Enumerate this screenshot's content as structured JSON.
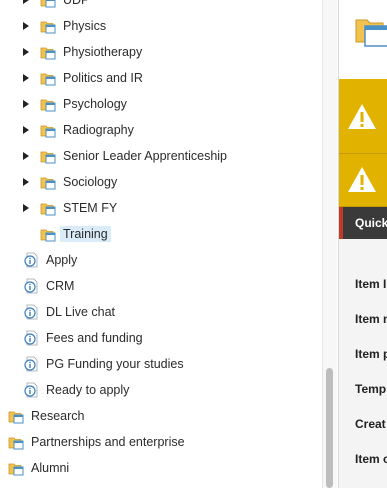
{
  "tree": {
    "items": [
      {
        "label": "UDP",
        "icon": "folder-page-icon",
        "arrow": true,
        "selected": false
      },
      {
        "label": "Physics",
        "icon": "folder-page-icon",
        "arrow": true,
        "selected": false
      },
      {
        "label": "Physiotherapy",
        "icon": "folder-page-icon",
        "arrow": true,
        "selected": false
      },
      {
        "label": "Politics and IR",
        "icon": "folder-page-icon",
        "arrow": true,
        "selected": false
      },
      {
        "label": "Psychology",
        "icon": "folder-page-icon",
        "arrow": true,
        "selected": false
      },
      {
        "label": "Radiography",
        "icon": "folder-page-icon",
        "arrow": true,
        "selected": false
      },
      {
        "label": "Senior Leader Apprenticeship",
        "icon": "folder-page-icon",
        "arrow": true,
        "selected": false
      },
      {
        "label": "Sociology",
        "icon": "folder-page-icon",
        "arrow": true,
        "selected": false
      },
      {
        "label": "STEM FY",
        "icon": "folder-page-icon",
        "arrow": true,
        "selected": false
      },
      {
        "label": "Training",
        "icon": "folder-page-icon",
        "arrow": false,
        "selected": true
      },
      {
        "label": "Apply",
        "icon": "info-page-icon",
        "arrow": false,
        "selected": false
      },
      {
        "label": "CRM",
        "icon": "info-page-icon",
        "arrow": false,
        "selected": false
      },
      {
        "label": "DL Live chat",
        "icon": "info-page-icon",
        "arrow": false,
        "selected": false
      },
      {
        "label": "Fees and funding",
        "icon": "info-page-icon",
        "arrow": false,
        "selected": false
      },
      {
        "label": "PG Funding your studies",
        "icon": "info-page-icon",
        "arrow": false,
        "selected": false
      },
      {
        "label": "Ready to apply",
        "icon": "info-page-icon",
        "arrow": false,
        "selected": false
      },
      {
        "label": "Research",
        "icon": "folder-page-icon",
        "arrow": false,
        "selected": false
      },
      {
        "label": "Partnerships and enterprise",
        "icon": "folder-page-icon",
        "arrow": false,
        "selected": false
      },
      {
        "label": "Alumni",
        "icon": "folder-page-icon",
        "arrow": false,
        "selected": false
      }
    ]
  },
  "right_panel": {
    "header_icon": "window-folder-icon",
    "warnings": [
      {
        "icon": "warning-icon"
      },
      {
        "icon": "warning-icon"
      }
    ],
    "quick_info_label": "Quick",
    "fields": [
      "Item I",
      "Item n",
      "Item p",
      "Temp",
      "Creat",
      "Item c"
    ]
  },
  "colors": {
    "warning_bg": "#e2b200",
    "quick_bg": "#3a3a3a",
    "quick_accent": "#c0392b",
    "selected_bg": "#d9ecf8"
  }
}
